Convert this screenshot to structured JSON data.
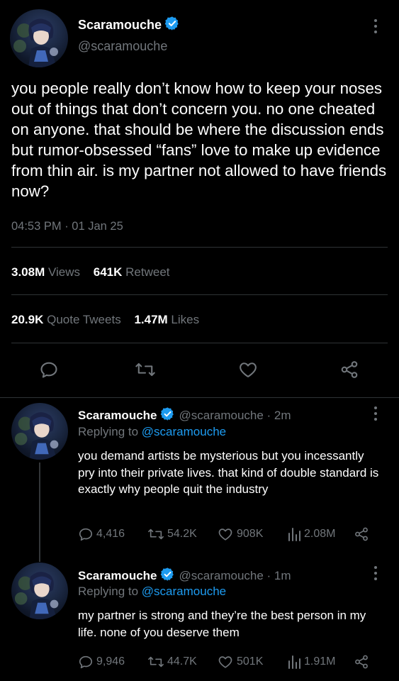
{
  "main_tweet": {
    "name": "Scaramouche",
    "handle": "@scaramouche",
    "text": "you people really don’t know how to keep your noses out of things that don’t concern you. no one cheated on anyone. that should be where the discussion ends but rumor-obsessed “fans” love to make up evidence from thin air. is my partner not allowed to have friends now?",
    "timestamp": "04:53 PM · 01 Jan 25",
    "views_count": "3.08M",
    "views_label": "Views",
    "retweet_count": "641K",
    "retweet_label": "Retweet",
    "quote_count": "20.9K",
    "quote_label": "Quote Tweets",
    "likes_count": "1.47M",
    "likes_label": "Likes"
  },
  "replies": [
    {
      "name": "Scaramouche",
      "handle_time": "@scaramouche · 2m",
      "replying_prefix": "Replying to",
      "replying_handle": "@scaramouche",
      "text": "you demand artists be mysterious but you incessantly pry into their private lives. that kind of double standard is exactly why people quit the industry",
      "replies": "4,416",
      "retweets": "54.2K",
      "likes": "908K",
      "views": "2.08M"
    },
    {
      "name": "Scaramouche",
      "handle_time": "@scaramouche · 1m",
      "replying_prefix": "Replying to",
      "replying_handle": "@scaramouche",
      "text": "my partner is strong and they’re the best person in my life. none of you deserve them",
      "replies": "9,946",
      "retweets": "44.7K",
      "likes": "501K",
      "views": "1.91M"
    }
  ],
  "colors": {
    "background": "#000000",
    "accent": "#1d9bf0",
    "muted": "#71767b",
    "divider": "#2f3336"
  },
  "icons": [
    "verified-badge-icon",
    "more-icon",
    "reply-icon",
    "retweet-icon",
    "like-icon",
    "share-icon",
    "views-icon"
  ]
}
